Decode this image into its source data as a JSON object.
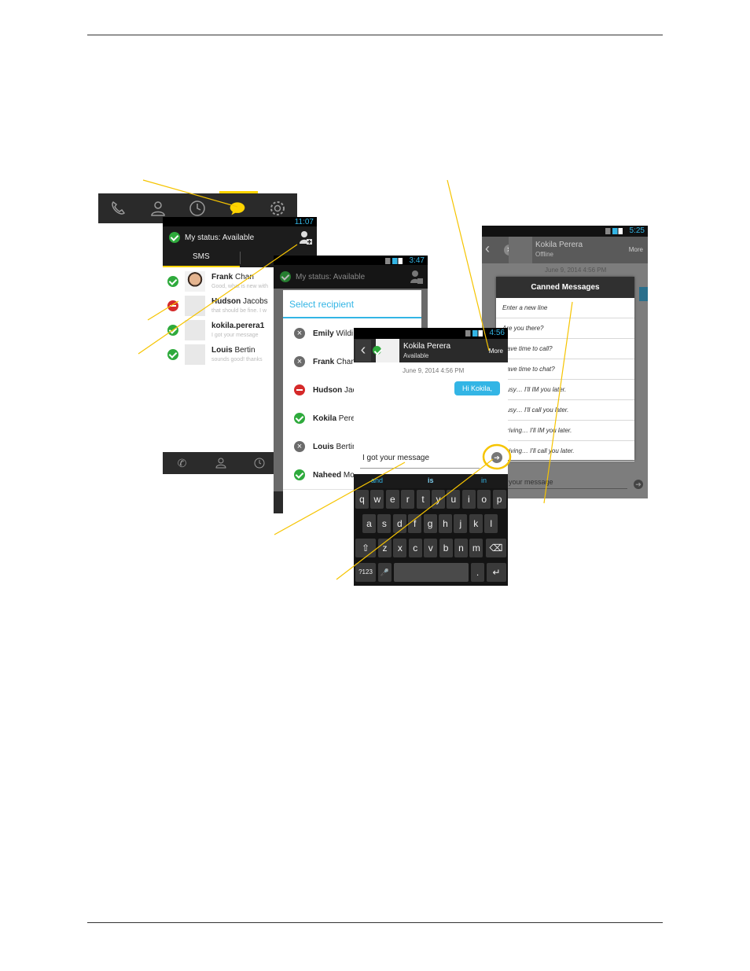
{
  "colors": {
    "accent": "#ffd400",
    "callout": "#f6c400",
    "blue": "#33b5e5",
    "green": "#2eaa3c",
    "red": "#d52a2a"
  },
  "tabbar": {
    "icons": [
      "phone-icon",
      "contacts-icon",
      "history-icon",
      "chat-icon",
      "settings-icon"
    ]
  },
  "screen1": {
    "time": "11:07",
    "status": "My status: Available",
    "tab": "SMS",
    "contacts": [
      {
        "first": "Frank",
        "last": "Chan",
        "preview": "Good, what is new with",
        "presence": "available",
        "photo": true
      },
      {
        "first": "Hudson",
        "last": "Jacobs",
        "preview": "that should be fine. I w",
        "presence": "busy",
        "photo": false
      },
      {
        "first": "kokila.perera1",
        "last": "",
        "preview": "I got your message",
        "presence": "available",
        "photo": false
      },
      {
        "first": "Louis",
        "last": "Bertin",
        "preview": "sounds good! thanks",
        "presence": "available",
        "photo": false
      }
    ]
  },
  "screen2": {
    "time": "3:47",
    "status": "My status: Available",
    "dialog_title": "Select recipient",
    "recipients": [
      {
        "first": "Emily",
        "last": "Wildi",
        "presence": "offline"
      },
      {
        "first": "Frank",
        "last": "Chan",
        "presence": "offline"
      },
      {
        "first": "Hudson",
        "last": "Jac",
        "presence": "busy"
      },
      {
        "first": "Kokila",
        "last": "Perer",
        "presence": "available"
      },
      {
        "first": "Louis",
        "last": "Bertin",
        "presence": "offline"
      },
      {
        "first": "Naheed",
        "last": "Mo",
        "presence": "available"
      }
    ]
  },
  "screen3": {
    "time": "4:56",
    "contact": "Kokila Perera",
    "availability": "Available",
    "more": "More",
    "timestamp": "June 9, 2014 4:56 PM",
    "bubble": "Hi Kokila,",
    "input": "I got your message",
    "suggestions": [
      "and",
      "is",
      "in"
    ],
    "keys_row1": [
      "q",
      "w",
      "e",
      "r",
      "t",
      "y",
      "u",
      "i",
      "o",
      "p"
    ],
    "keys_row2": [
      "a",
      "s",
      "d",
      "f",
      "g",
      "h",
      "j",
      "k",
      "l"
    ],
    "keys_row3": [
      "z",
      "x",
      "c",
      "v",
      "b",
      "n",
      "m"
    ],
    "sym_key": "?123",
    "period_key": "."
  },
  "screen4": {
    "time": "5:25",
    "contact": "Kokila Perera",
    "availability": "Offline",
    "more": "More",
    "timestamp": "June 9, 2014 4:56 PM",
    "dialog_title": "Canned Messages",
    "items": [
      "Enter a new line",
      "Are you there?",
      "Have time to call?",
      "Have time to chat?",
      "Busy… I'll IM you later.",
      "Busy… I'll call you later.",
      "Driving… I'll IM you later.",
      "Driving… I'll call you later."
    ],
    "input_placeholder": "your message"
  }
}
